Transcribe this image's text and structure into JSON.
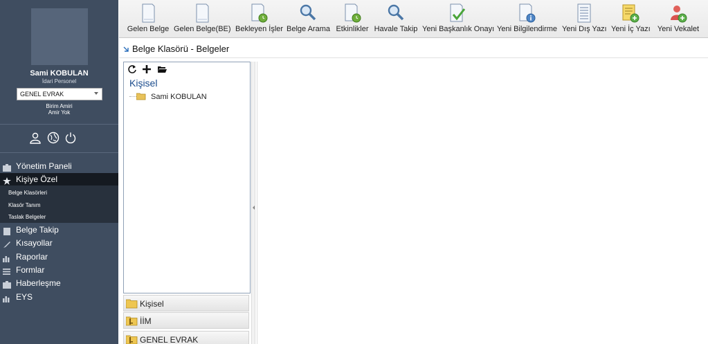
{
  "user": {
    "name": "Sami KOBULAN",
    "role": "İdari Personel",
    "unit_selected": "GENEL EVRAK",
    "unit_manager_line1": "Birim Amiri",
    "unit_manager_line2": "Amir Yok"
  },
  "sidebar": {
    "action_icons": [
      "user-icon",
      "globe-icon",
      "power-icon"
    ],
    "menu": [
      {
        "label": "Yönetim Paneli",
        "icon": "briefcase-icon"
      },
      {
        "label": "Kişiye Özel",
        "icon": "star-icon",
        "active": true
      },
      {
        "label": "Belge Takip",
        "icon": "document-icon"
      },
      {
        "label": "Kısayollar",
        "icon": "pencil-icon"
      },
      {
        "label": "Raporlar",
        "icon": "bar-chart-icon"
      },
      {
        "label": "Formlar",
        "icon": "list-icon"
      },
      {
        "label": "Haberleşme",
        "icon": "briefcase-icon"
      },
      {
        "label": "EYS",
        "icon": "bar-chart-icon"
      }
    ],
    "submenu": [
      {
        "label": "Belge Klasörleri"
      },
      {
        "label": "Klasör Tanım"
      },
      {
        "label": "Taslak Belgeler"
      }
    ]
  },
  "toolbar": {
    "items": [
      {
        "label": "Gelen Belge",
        "icon": "document-icon"
      },
      {
        "label": "Gelen Belge(BE)",
        "icon": "document-icon"
      },
      {
        "label": "Bekleyen İşler",
        "icon": "document-clock-icon"
      },
      {
        "label": "Belge Arama",
        "icon": "search-icon"
      },
      {
        "label": "Etkinlikler",
        "icon": "document-clock-icon"
      },
      {
        "label": "Havale Takip",
        "icon": "search-icon"
      },
      {
        "label": "Yeni Başkanlık Onayı",
        "icon": "document-check-icon"
      },
      {
        "label": "Yeni Bilgilendirme",
        "icon": "document-info-icon"
      },
      {
        "label": "Yeni Dış Yazı",
        "icon": "lined-document-icon"
      },
      {
        "label": "Yeni İç Yazı",
        "icon": "note-add-icon"
      },
      {
        "label": "Yeni Vekalet",
        "icon": "user-add-icon"
      }
    ]
  },
  "page": {
    "title": "Belge Klasörü - Belgeler"
  },
  "tree": {
    "tools": [
      "refresh-icon",
      "plus-icon",
      "open-folder-icon"
    ],
    "root_label": "Kişisel",
    "nodes": [
      {
        "label": "Sami KOBULAN"
      }
    ]
  },
  "accordion": [
    {
      "label": "Kişisel",
      "icon": "folder-icon"
    },
    {
      "label": "İİM",
      "icon": "folder-key-icon"
    },
    {
      "label": "GENEL EVRAK",
      "icon": "folder-key-icon"
    }
  ],
  "colors": {
    "sidebar_bg": "#3f4d60",
    "sidebar_active": "#151a21",
    "accent_blue": "#1a4b8c"
  }
}
